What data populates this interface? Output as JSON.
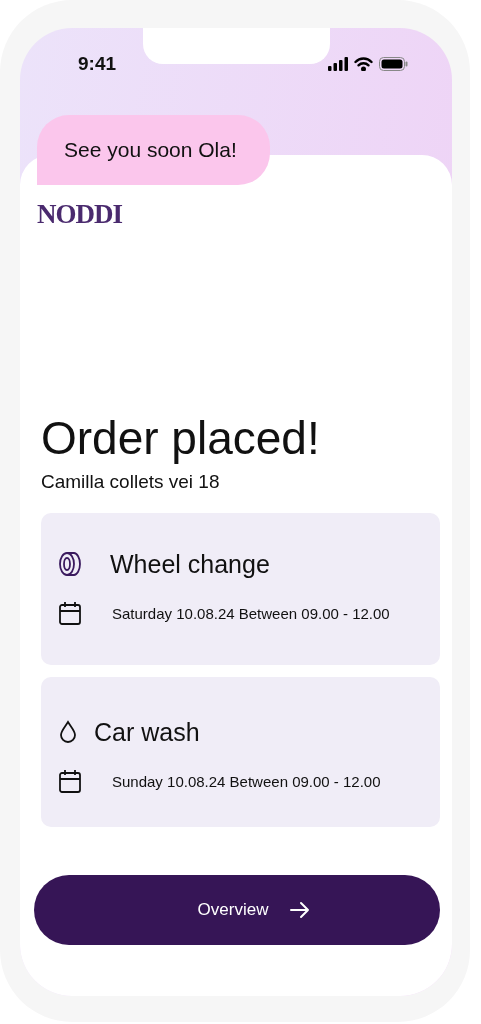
{
  "status_bar": {
    "time": "9:41"
  },
  "greeting": "See you soon Ola!",
  "logo": "NODDI",
  "title": "Order placed!",
  "address": "Camilla collets vei 18",
  "services": [
    {
      "kind": "wheel",
      "name": "Wheel change",
      "schedule": "Saturday 10.08.24 Between 09.00 - 12.00"
    },
    {
      "kind": "wash",
      "name": "Car wash",
      "schedule": "Sunday 10.08.24 Between 09.00 - 12.00"
    }
  ],
  "button": "Overview"
}
